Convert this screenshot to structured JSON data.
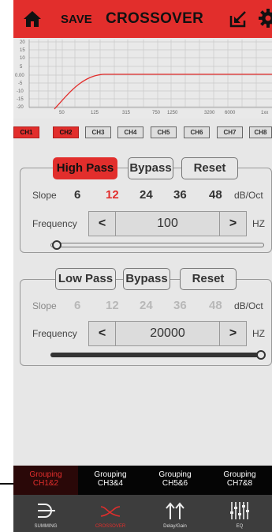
{
  "header": {
    "save_label": "SAVE",
    "title": "CROSSOVER",
    "home_icon": "home-icon",
    "import_icon": "import-icon",
    "settings_icon": "gear-icon",
    "bg_color": "#e22e2c"
  },
  "graph": {
    "y_labels": [
      "20",
      "15",
      "10",
      "5",
      "0.00",
      "-5",
      "-10",
      "-15",
      "-20"
    ],
    "x_labels": [
      "50",
      "125",
      "315",
      "750",
      "1250",
      "3200",
      "6000",
      "1xx"
    ]
  },
  "channels": [
    "CH1",
    "CH2",
    "CH3",
    "CH4",
    "CH5",
    "CH6",
    "CH7",
    "CH8"
  ],
  "high_pass": {
    "tab_label": "High Pass",
    "bypass_label": "Bypass",
    "reset_label": "Reset",
    "slope_label": "Slope",
    "slopes": [
      "6",
      "12",
      "24",
      "36",
      "48"
    ],
    "slope_unit": "dB/Oct",
    "frequency_label": "Frequency",
    "dec_label": "<",
    "inc_label": ">",
    "frequency_value": "100",
    "frequency_unit": "HZ",
    "slider_level": 0.03
  },
  "low_pass": {
    "tab_label": "Low Pass",
    "bypass_label": "Bypass",
    "reset_label": "Reset",
    "slope_label": "Slope",
    "slopes": [
      "6",
      "12",
      "24",
      "36",
      "48"
    ],
    "slope_unit": "dB/Oct",
    "frequency_label": "Frequency",
    "dec_label": "<",
    "inc_label": ">",
    "frequency_value": "20000",
    "frequency_unit": "HZ",
    "slider_level": 1.0
  },
  "groupings": [
    {
      "line1": "Grouping",
      "line2": "CH1&2"
    },
    {
      "line1": "Grouping",
      "line2": "CH3&4"
    },
    {
      "line1": "Grouping",
      "line2": "CH5&6"
    },
    {
      "line1": "Grouping",
      "line2": "CH7&8"
    }
  ],
  "nav": [
    {
      "label": "SUMMING",
      "icon": "summing-icon"
    },
    {
      "label": "CROSSOVER",
      "icon": "crossover-icon"
    },
    {
      "label": "Delay/Gain",
      "icon": "delay-gain-icon"
    },
    {
      "label": "EQ",
      "icon": "eq-icon"
    }
  ]
}
